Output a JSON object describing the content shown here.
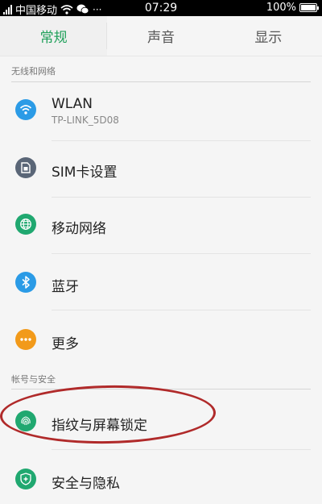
{
  "status_bar": {
    "carrier": "中国移动",
    "time": "07:29",
    "battery": "100%",
    "battery_level": 1.0
  },
  "tabs": [
    {
      "label": "常规",
      "active": true
    },
    {
      "label": "声音",
      "active": false
    },
    {
      "label": "显示",
      "active": false
    }
  ],
  "sections": {
    "network": {
      "title": "无线和网络"
    },
    "account": {
      "title": "帐号与安全"
    }
  },
  "items": [
    {
      "label": "WLAN",
      "sub": "TP-LINK_5D08",
      "icon": "wifi-icon",
      "color": "#2b9be6"
    },
    {
      "label": "SIM卡设置",
      "icon": "sim-card-icon",
      "color": "#5a6677"
    },
    {
      "label": "移动网络",
      "icon": "globe-icon",
      "color": "#20a870"
    },
    {
      "label": "蓝牙",
      "icon": "bluetooth-icon",
      "color": "#2b9be6"
    },
    {
      "label": "更多",
      "icon": "more-icon",
      "color": "#f29a1a"
    },
    {
      "label": "指纹与屏幕锁定",
      "icon": "fingerprint-icon",
      "color": "#20a870"
    },
    {
      "label": "安全与隐私",
      "icon": "shield-icon",
      "color": "#20a870"
    }
  ],
  "colors": {
    "accent_green": "#1fa05a",
    "annotation_red": "#b02a2a"
  }
}
